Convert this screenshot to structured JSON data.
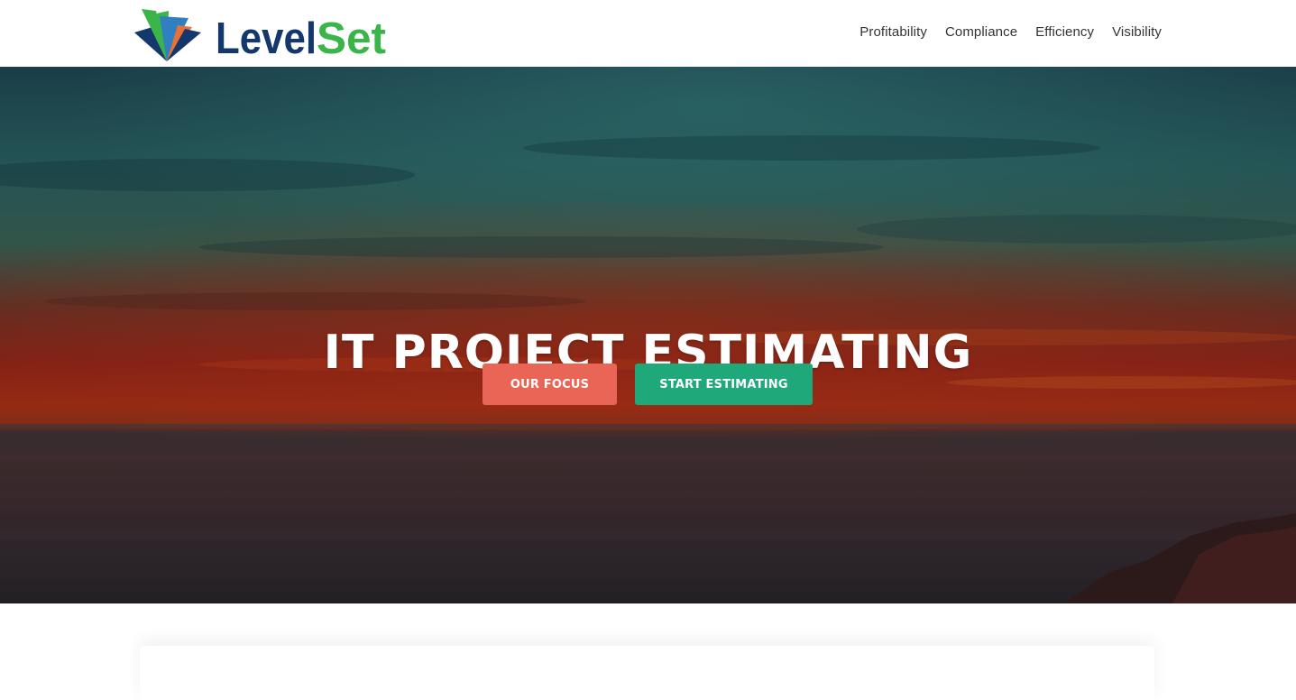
{
  "brand": {
    "name_part1": "Level",
    "name_part2": "Set",
    "colors": {
      "navy": "#14386b",
      "green": "#39b54a",
      "blue": "#2f7fc1",
      "orange": "#e8713a"
    }
  },
  "nav": {
    "items": [
      {
        "label": "Profitability"
      },
      {
        "label": "Compliance"
      },
      {
        "label": "Efficiency"
      },
      {
        "label": "Visibility"
      }
    ]
  },
  "hero": {
    "title": "IT PROJECT ESTIMATING",
    "background": "sunset-over-sea-photo",
    "buttons": {
      "focus_label": "OUR FOCUS",
      "start_label": "START ESTIMATING"
    },
    "colors": {
      "focus_button": "#e96656",
      "start_button": "#1fa87a"
    }
  }
}
